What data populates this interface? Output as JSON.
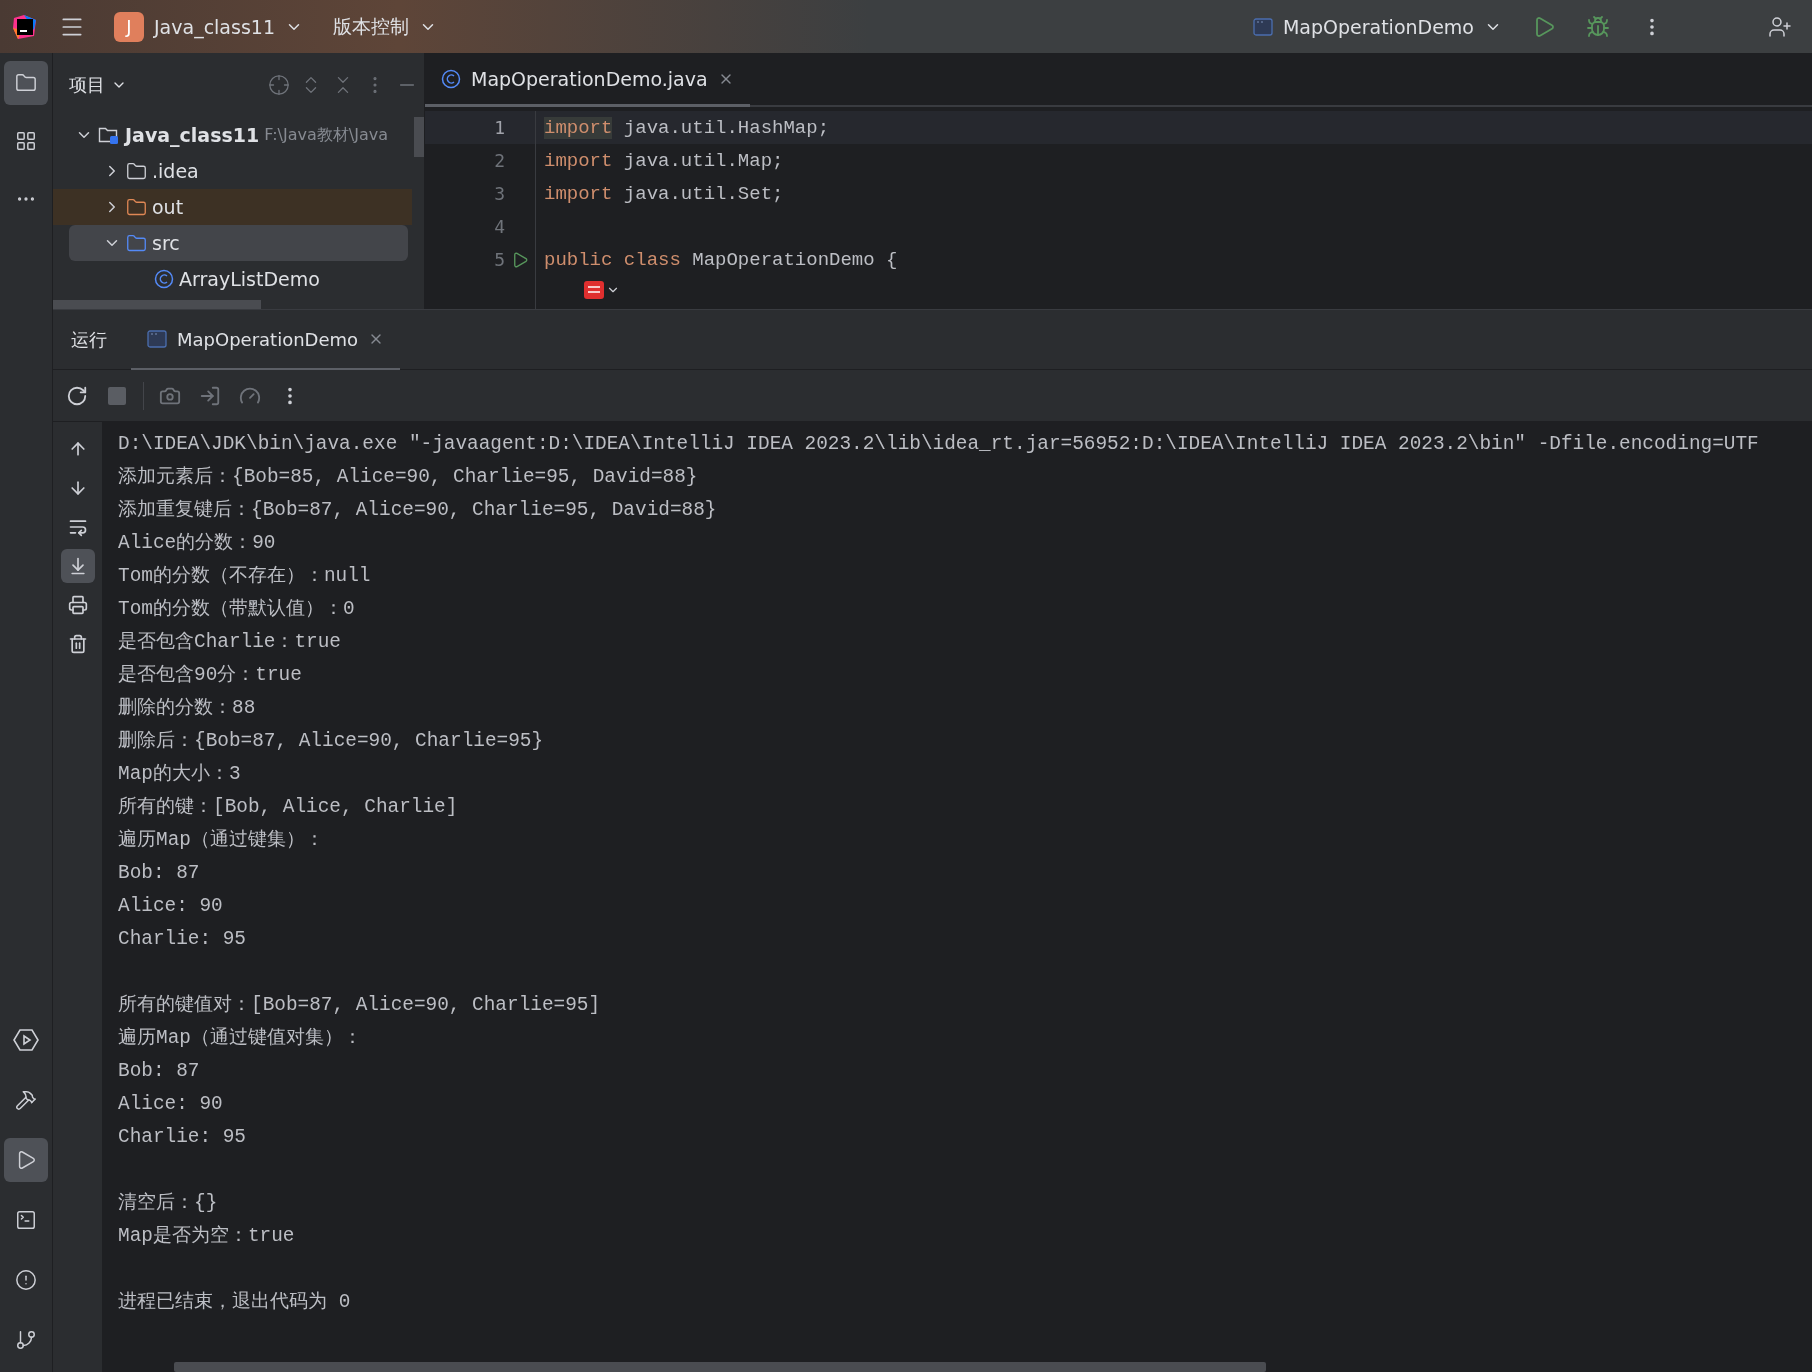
{
  "top_bar": {
    "project": {
      "badge": "J",
      "name": "Java_class11"
    },
    "vcs": "版本控制",
    "run_config": "MapOperationDemo"
  },
  "tool_strip": {
    "top": [
      {
        "kind": "project",
        "selected": true
      },
      {
        "kind": "structure",
        "selected": false
      },
      {
        "kind": "more",
        "selected": false
      }
    ],
    "bottom": [
      {
        "kind": "services",
        "selected": false
      },
      {
        "kind": "build",
        "selected": false
      },
      {
        "kind": "run",
        "selected": true
      },
      {
        "kind": "terminal",
        "selected": false
      },
      {
        "kind": "problems",
        "selected": false
      },
      {
        "kind": "git",
        "selected": false
      }
    ]
  },
  "project_panel": {
    "title": "项目",
    "tree": [
      {
        "label": "Java_class11",
        "path": "F:\\Java教材\\Java",
        "kind": "module",
        "expanded": true,
        "selected": false,
        "children": [
          {
            "label": ".idea",
            "kind": "folder",
            "expanded": false,
            "selected": false
          },
          {
            "label": "out",
            "kind": "excluded",
            "expanded": false,
            "selected": false
          },
          {
            "label": "src",
            "kind": "source",
            "expanded": true,
            "selected": true,
            "children": [
              {
                "label": "ArrayListDemo",
                "kind": "class",
                "selected": false
              }
            ]
          }
        ]
      }
    ]
  },
  "editor": {
    "tabs": [
      {
        "label": "MapOperationDemo.java",
        "selected": true
      }
    ],
    "lines": [
      {
        "number": "1",
        "current": true,
        "tokens": [
          {
            "text": "import",
            "kind": "keyword",
            "highlight": true
          },
          {
            "text": " java.util.HashMap;",
            "kind": "plain",
            "highlight": false
          }
        ]
      },
      {
        "number": "2",
        "current": false,
        "tokens": [
          {
            "text": "import",
            "kind": "keyword",
            "highlight": false
          },
          {
            "text": " java.util.Map;",
            "kind": "plain",
            "highlight": false
          }
        ]
      },
      {
        "number": "3",
        "current": false,
        "tokens": [
          {
            "text": "import",
            "kind": "keyword",
            "highlight": false
          },
          {
            "text": " java.util.Set;",
            "kind": "plain",
            "highlight": false
          }
        ]
      },
      {
        "number": "4",
        "current": false
      },
      {
        "number": "5",
        "current": false,
        "run_marker": true,
        "tokens": [
          {
            "text": "public",
            "kind": "keyword",
            "highlight": false
          },
          {
            "text": " class",
            "kind": "keyword",
            "highlight": false
          },
          {
            "text": " MapOperationDemo {",
            "kind": "plain",
            "highlight": false
          }
        ]
      },
      {
        "current": false,
        "inlay": true
      }
    ]
  },
  "run_panel": {
    "title": "运行",
    "tabs": [
      {
        "label": "MapOperationDemo",
        "selected": true
      }
    ],
    "console_blocks": [
      [
        "D:\\IDEA\\JDK\\bin\\java.exe \"-javaagent:D:\\IDEA\\IntelliJ IDEA 2023.2\\lib\\idea_rt.jar=56952:D:\\IDEA\\IntelliJ IDEA 2023.2\\bin\" -Dfile.encoding=UTF",
        "添加元素后：{Bob=85, Alice=90, Charlie=95, David=88}",
        "添加重复键后：{Bob=87, Alice=90, Charlie=95, David=88}",
        "Alice的分数：90",
        "Tom的分数（不存在）：null",
        "Tom的分数（带默认值）：0",
        "是否包含Charlie：true",
        "是否包含90分：true",
        "删除的分数：88",
        "删除后：{Bob=87, Alice=90, Charlie=95}",
        "Map的大小：3",
        "所有的键：[Bob, Alice, Charlie]",
        "遍历Map（通过键集）：",
        "Bob: 87",
        "Alice: 90",
        "Charlie: 95"
      ],
      [
        "所有的键值对：[Bob=87, Alice=90, Charlie=95]",
        "遍历Map（通过键值对集）：",
        "Bob: 87",
        "Alice: 90",
        "Charlie: 95"
      ],
      [
        "清空后：{}",
        "Map是否为空：true"
      ],
      [
        "进程已结束，退出代码为 0"
      ]
    ],
    "gutter": [
      {
        "kind": "up",
        "selected": false
      },
      {
        "kind": "down",
        "selected": false
      },
      {
        "kind": "wrap",
        "selected": false
      },
      {
        "kind": "scroll_end",
        "selected": true
      },
      {
        "kind": "print",
        "selected": false
      },
      {
        "kind": "clear",
        "selected": false
      }
    ]
  }
}
